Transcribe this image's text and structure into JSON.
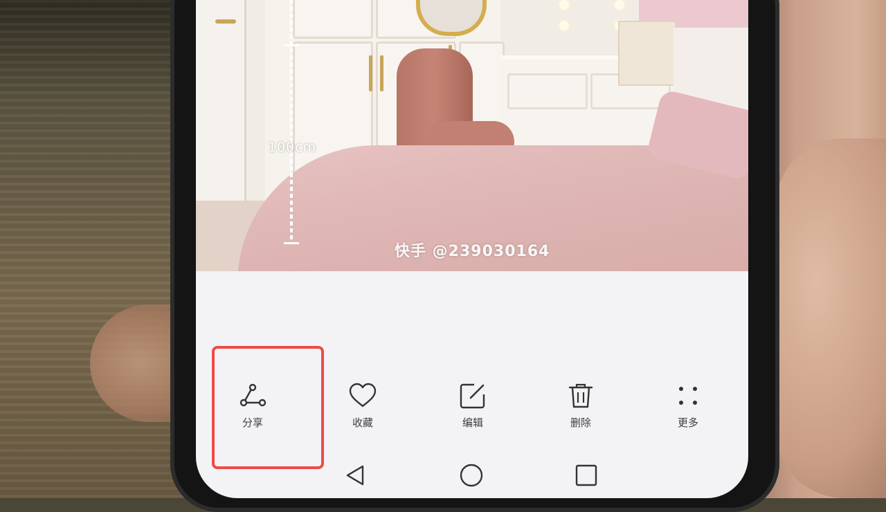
{
  "photo": {
    "measure_label": "100cm",
    "watermark": "快手 @239030164"
  },
  "toolbar": {
    "items": [
      {
        "label": "分享",
        "icon": "share-icon"
      },
      {
        "label": "收藏",
        "icon": "heart-icon"
      },
      {
        "label": "编辑",
        "icon": "edit-icon"
      },
      {
        "label": "删除",
        "icon": "trash-icon"
      },
      {
        "label": "更多",
        "icon": "more-icon"
      }
    ],
    "highlighted_item": "分享",
    "highlight_color": "#ee4a46"
  },
  "navbar": {
    "buttons": [
      "back-icon",
      "home-icon",
      "recents-icon"
    ]
  }
}
